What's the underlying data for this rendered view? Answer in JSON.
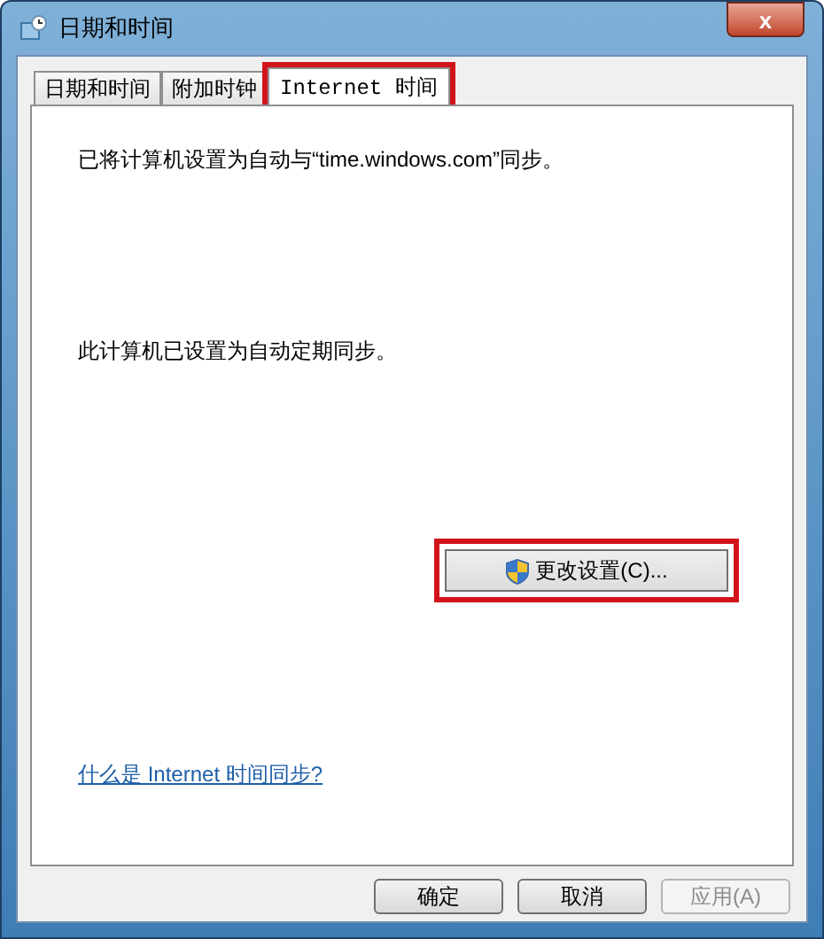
{
  "window": {
    "title": "日期和时间",
    "close": "x"
  },
  "tabs": [
    {
      "label": "日期和时间",
      "selected": false,
      "highlighted": false
    },
    {
      "label": "附加时钟",
      "selected": false,
      "highlighted": false
    },
    {
      "label": "Internet 时间",
      "selected": true,
      "highlighted": true
    }
  ],
  "status_text": "已将计算机设置为自动与“time.windows.com”同步。",
  "sync_text": "此计算机已设置为自动定期同步。",
  "change_button": {
    "label": "更改设置(C)...",
    "highlighted": true
  },
  "help_link": "什么是 Internet 时间同步?",
  "buttons": [
    {
      "label": "确定",
      "disabled": false
    },
    {
      "label": "取消",
      "disabled": false
    },
    {
      "label": "应用(A)",
      "disabled": true
    }
  ]
}
